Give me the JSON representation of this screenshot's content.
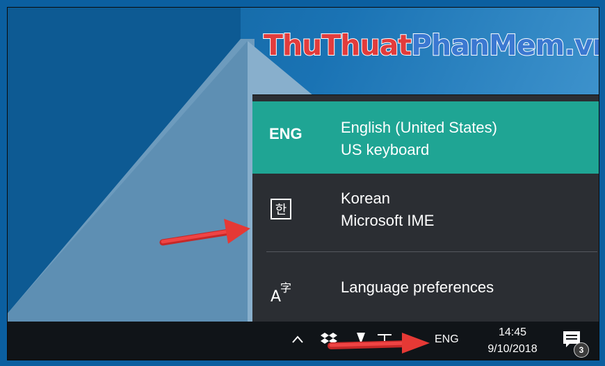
{
  "watermark": {
    "part1": "ThuThuat",
    "part2": "PhanMem.vn"
  },
  "language_flyout": {
    "items": [
      {
        "code": "ENG",
        "name": "English (United States)",
        "keyboard": "US keyboard",
        "selected": true
      },
      {
        "icon": "korean-ime-icon",
        "icon_glyph": "한",
        "name": "Korean",
        "keyboard": "Microsoft IME",
        "selected": false
      }
    ],
    "preferences_label": "Language preferences",
    "preferences_icon": "language-preferences-icon"
  },
  "taskbar": {
    "language_indicator": "ENG",
    "time": "14:45",
    "date": "9/10/2018",
    "notification_count": "3",
    "icons": [
      "show-hidden-icons-chevron",
      "dropbox-icon",
      "network-icon",
      "volume-icon",
      "action-center-icon"
    ]
  },
  "colors": {
    "accent": "#1fa594",
    "flyout_bg": "#2b2e33",
    "taskbar_bg": "#101418",
    "annotation_arrow": "#e53935"
  }
}
